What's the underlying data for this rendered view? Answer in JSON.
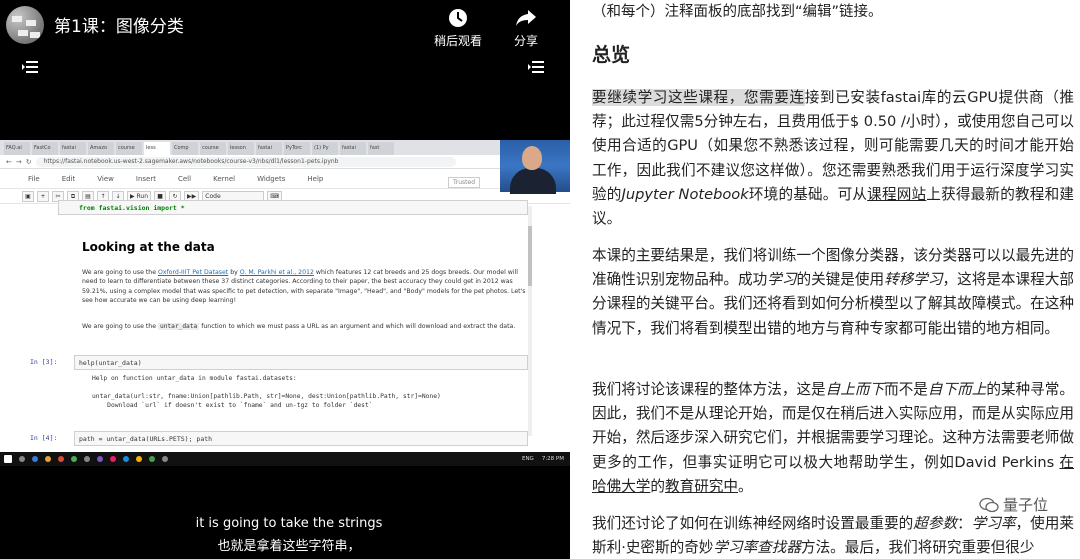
{
  "video": {
    "title": "第1课：图像分类",
    "watch_later_label": "稍后观看",
    "share_label": "分享",
    "subtitle_en": "it is going to take the strings",
    "subtitle_zh": "也就是拿着这些字符串，"
  },
  "screen": {
    "url": "https://fastai.notebook.us-west-2.sagemaker.aws/notebooks/course-v3/nbs/dl1/lesson1-pets.ipynb",
    "tabs": [
      "FAQ.ai",
      "FastCo",
      "fastai",
      "Amazo",
      "course",
      "less",
      "Comp",
      "course",
      "lesson",
      "fastai",
      "PyTorc",
      "(1) Py",
      "fastai",
      "fast"
    ],
    "menu": [
      "File",
      "Edit",
      "View",
      "Insert",
      "Cell",
      "Kernel",
      "Widgets",
      "Help"
    ],
    "trusted": "Trusted",
    "run_label": "Run",
    "cell_type": "Code",
    "first_code": "from fastai.vision import *",
    "heading": "Looking at the data",
    "para1_pre": "We are going to use the ",
    "para1_link1": "Oxford-IIIT Pet Dataset",
    "para1_mid": " by ",
    "para1_link2": "O. M. Parkhi et al., 2012",
    "para1_post": " which features 12 cat breeds and 25 dogs breeds. Our model will need to learn to differentiate between these 37 distinct categories. According to their paper, the best accuracy they could get in 2012 was 59.21%, using a complex model that was specific to pet detection, with separate \"Image\", \"Head\", and \"Body\" models for the pet photos. Let's see how accurate we can be using deep learning!",
    "para2_pre": "We are going to use the ",
    "para2_code": "untar_data",
    "para2_post": " function to which we must pass a URL as an argument and which will download and extract the data.",
    "prompt3": "In [3]:",
    "code3": "help(untar_data)",
    "out3": "Help on function untar_data in module fastai.datasets:\n\nuntar_data(url:str, fname:Union[pathlib.Path, str]=None, dest:Union[pathlib.Path, str]=None)\n    Download `url` if doesn't exist to `fname` and un-tgz to folder `dest`",
    "prompt4": "In [4]:",
    "code4": "path = untar_data(URLs.PETS); path",
    "tray_lang": "ENG",
    "tray_time": "7:28 PM"
  },
  "article": {
    "top_line": "（和每个）注释面板的底部找到“编辑”链接。",
    "heading": "总览",
    "p1_hl": "要继续学习这些课程，您需要连",
    "p1_a": "接到已安装fastai库的云GPU提供商（推荐；此过程仅需5分钟左右，且费用低于$ 0.50 /小时），或使用您自己可以使用合适的GPU（如果您不熟悉该过程，则可能需要几天的时间才能开始工作，因此我们不建议您这样做）。您还需要熟悉我们用于运行深度学习实验的",
    "p1_em": "Jupyter Notebook",
    "p1_b": "环境的基础。可从",
    "p1_link": "课程网站",
    "p1_c": "上获得最新的教程和建议。",
    "p2_a": "本课的主要结果是，我们将训练一个图像分类器，该分类器可以以最先进的准确性识别宠物品种。成功",
    "p2_em1": "学习",
    "p2_b": "的关键是使用",
    "p2_em2": "转移学习",
    "p2_c": "，这将是本课程大部分课程的关键平台。我们还将看到如何分析模型以了解其故障模式。在这种情况下，我们将看到模型出错的地方与育种专家都可能出错的地方相同。",
    "p3_a": "我们将讨论该课程的整体方法，这是",
    "p3_em1": "自上而下",
    "p3_b": "而不是",
    "p3_em2": "自下而上",
    "p3_c": "的某种寻常。因此，我们不是从理论开始，而是仅在稍后进入实际应用，而是从实际应用开始，然后逐步深入研究它们，并根据需要学习理论。这种方法需要老师做更多的工作，但事实证明它可以极大地帮助学生，例如David Perkins ",
    "p3_link1": "在哈佛大学",
    "p3_d": "的",
    "p3_link2": "教育研究中",
    "p3_e": "。",
    "p4_a": "我们还讨论了如何在训练神经网络时设置最重要的",
    "p4_em1": "超参数",
    "p4_b": "：",
    "p4_em2": "学习率",
    "p4_c": "，使用莱斯利·史密斯的奇妙",
    "p4_em3": "学习率查找器",
    "p4_d": "方法。最后，我们将研究重要但很少",
    "watermark": "量子位"
  }
}
